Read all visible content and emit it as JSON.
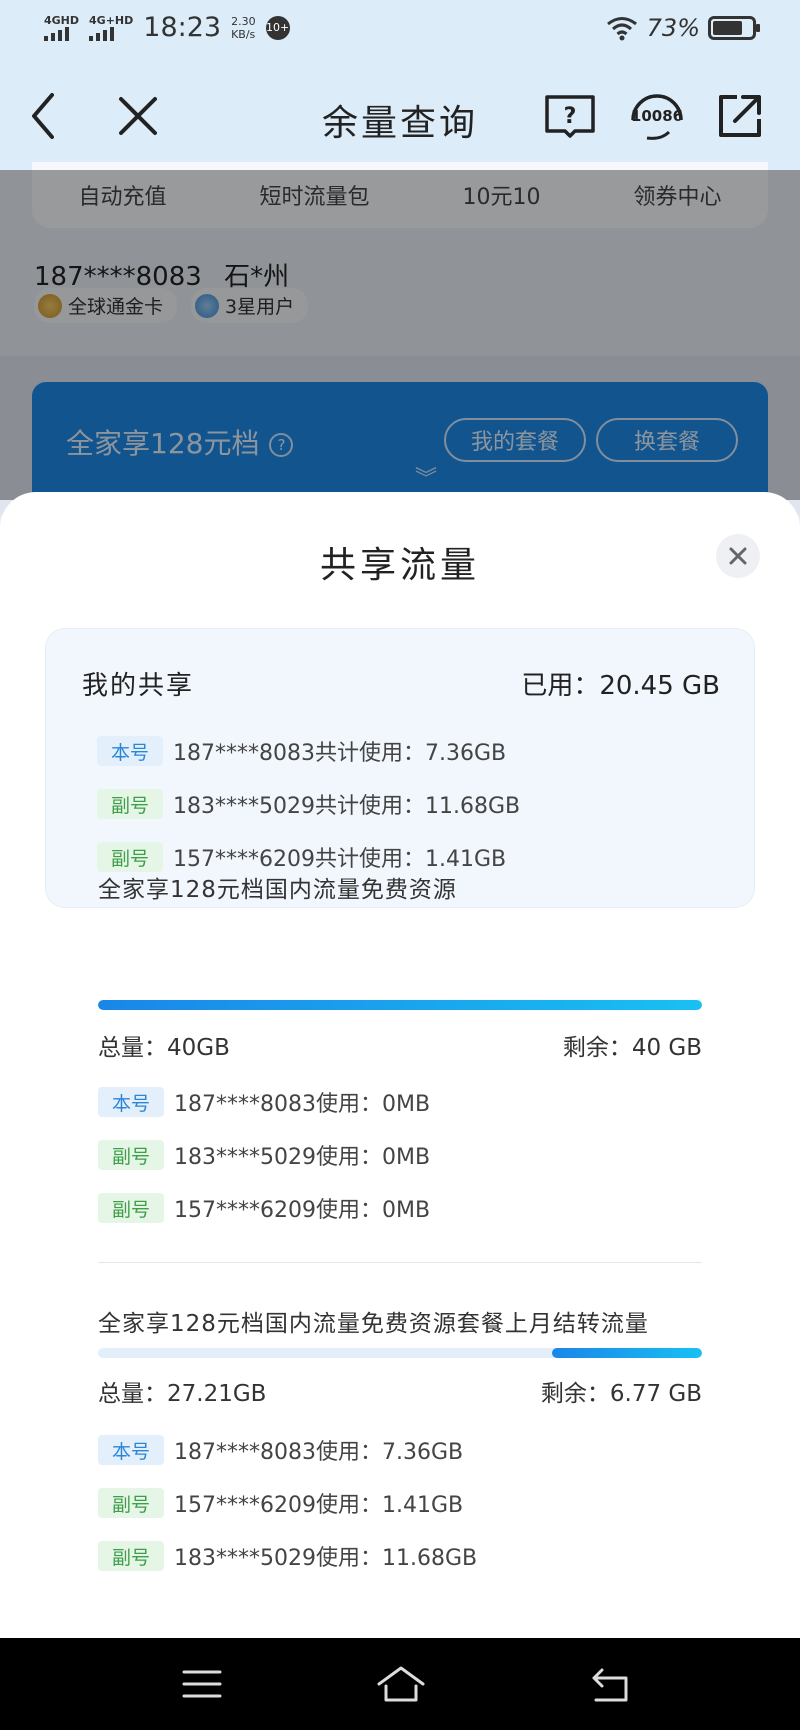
{
  "status_bar": {
    "signal1": "4GHD",
    "signal2": "4G+HD",
    "time": "18:23",
    "speed_value": "2.30",
    "speed_unit": "KB/s",
    "notif_badge": "10+",
    "battery_pct": "73%"
  },
  "header": {
    "title": "余量查询",
    "icons": [
      "back-icon",
      "close-icon",
      "help-book-icon",
      "service-10086-icon",
      "share-icon"
    ],
    "service_label": "10086"
  },
  "background": {
    "quick_actions": [
      "自动充值",
      "短时流量包",
      "10元10",
      "领券中心"
    ],
    "phone": "187****8083",
    "location": "石*州",
    "tags": [
      "全球通金卡",
      "3星用户"
    ],
    "plan_name": "全家享128元档",
    "plan_buttons": [
      "我的套餐",
      "换套餐"
    ]
  },
  "sheet": {
    "title": "共享流量",
    "my_share": {
      "title": "我的共享",
      "used": "已用：20.45 GB",
      "rows": [
        {
          "badge": "本号",
          "type": "main",
          "text": "187****8083共计使用：7.36GB"
        },
        {
          "badge": "副号",
          "type": "sub",
          "text": "183****5029共计使用：11.68GB"
        },
        {
          "badge": "副号",
          "type": "sub",
          "text": "157****6209共计使用：1.41GB"
        }
      ]
    },
    "sections": [
      {
        "title": "全家享128元档国内流量免费资源",
        "total": "总量：40GB",
        "remaining": "剩余：40 GB",
        "remaining_fraction": 1.0,
        "rows": [
          {
            "badge": "本号",
            "type": "main",
            "text": "187****8083使用：0MB"
          },
          {
            "badge": "副号",
            "type": "sub",
            "text": "183****5029使用：0MB"
          },
          {
            "badge": "副号",
            "type": "sub",
            "text": "157****6209使用：0MB"
          }
        ]
      },
      {
        "title": "全家享128元档国内流量免费资源套餐上月结转流量",
        "total": "总量：27.21GB",
        "remaining": "剩余：6.77 GB",
        "remaining_fraction": 0.249,
        "rows": [
          {
            "badge": "本号",
            "type": "main",
            "text": "187****8083使用：7.36GB"
          },
          {
            "badge": "副号",
            "type": "sub",
            "text": "157****6209使用：1.41GB"
          },
          {
            "badge": "副号",
            "type": "sub",
            "text": "183****5029使用：11.68GB"
          }
        ]
      }
    ]
  },
  "nav_bar": {
    "icons": [
      "menu-icon",
      "home-icon",
      "back-nav-icon"
    ]
  },
  "colors": {
    "accent": "#1e88e5",
    "main_badge": "#2c86d8",
    "sub_badge": "#3f9e4a"
  }
}
